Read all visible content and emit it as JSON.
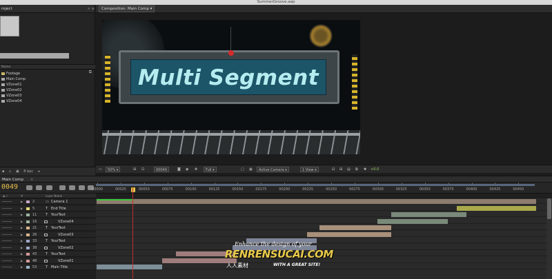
{
  "window": {
    "title": "SummerGroove.aep"
  },
  "project_panel": {
    "tab_label": "roject",
    "column_name": "Name",
    "items": [
      {
        "label": "Footage",
        "kind": "folder"
      },
      {
        "label": "Main Comp",
        "kind": "comp"
      },
      {
        "label": "VZone01",
        "kind": "comp"
      },
      {
        "label": "VZone02",
        "kind": "comp"
      },
      {
        "label": "VZone03",
        "kind": "comp"
      },
      {
        "label": "VZone04",
        "kind": "comp"
      }
    ],
    "bpc": "8 bpc"
  },
  "composition_panel": {
    "tab_label": "Composition: Main Comp",
    "viewer_text": "Multi Segment",
    "toolbar": {
      "zoom": "50%",
      "timecode": "00049",
      "resolution": "Full",
      "camera": "Active Camera",
      "views": "1 View",
      "exposure": "+0.0"
    }
  },
  "timeline": {
    "tab_label": "Main Comp",
    "current_time": "0049",
    "column_layer_name": "Layer Name",
    "ruler_ticks": [
      "00000",
      "00025",
      "00050",
      "00075",
      "00100",
      "00125",
      "00150",
      "00175",
      "00200",
      "00225",
      "00250",
      "00275",
      "00300",
      "00325",
      "00350",
      "00375",
      "00400",
      "00425",
      "00450"
    ],
    "layers": [
      {
        "num": "2",
        "name": "Camera 1",
        "kind": "camera",
        "label_color": "#c4a8c4",
        "bar_color": "#8d7d6f",
        "start": 0,
        "end": 470
      },
      {
        "num": "5",
        "name": "End Title",
        "kind": "text",
        "label_color": "#e6d97a",
        "bar_color": "#a9a94c",
        "start": 385,
        "end": 470
      },
      {
        "num": "11",
        "name": "YourText",
        "kind": "text",
        "label_color": "#9fb59f",
        "bar_color": "#7a8a7a",
        "start": 315,
        "end": 395
      },
      {
        "num": "16",
        "name": "VZone04",
        "kind": "precomp",
        "label_color": "#9fb59f",
        "bar_color": "#7a8a7a",
        "start": 300,
        "end": 375
      },
      {
        "num": "21",
        "name": "YourText",
        "kind": "text",
        "label_color": "#d8b48a",
        "bar_color": "#a8907a",
        "start": 238,
        "end": 315
      },
      {
        "num": "26",
        "name": "VZone03",
        "kind": "precomp",
        "label_color": "#d8b48a",
        "bar_color": "#a8907a",
        "start": 225,
        "end": 315
      },
      {
        "num": "33",
        "name": "YourText",
        "kind": "text",
        "label_color": "#a0a8c8",
        "bar_color": "#7f8598",
        "start": 160,
        "end": 235
      },
      {
        "num": "38",
        "name": "VZone02",
        "kind": "precomp",
        "label_color": "#a0a8c8",
        "bar_color": "#7f8598",
        "start": 145,
        "end": 235
      },
      {
        "num": "43",
        "name": "YourText",
        "kind": "text",
        "label_color": "#d49a9a",
        "bar_color": "#a07d7d",
        "start": 85,
        "end": 150
      },
      {
        "num": "48",
        "name": "VZone01",
        "kind": "precomp",
        "label_color": "#d49a9a",
        "bar_color": "#a07d7d",
        "start": 70,
        "end": 150
      },
      {
        "num": "53",
        "name": "Main Title",
        "kind": "text",
        "label_color": "#9fb8c8",
        "bar_color": "#7d8f98",
        "start": 0,
        "end": 70
      }
    ]
  },
  "watermark": {
    "line1": "Enhance the design of your",
    "line2": "RENRENSUCAI.COM",
    "line3": "人人素材",
    "line4": "WITH A GREAT SITE!"
  }
}
